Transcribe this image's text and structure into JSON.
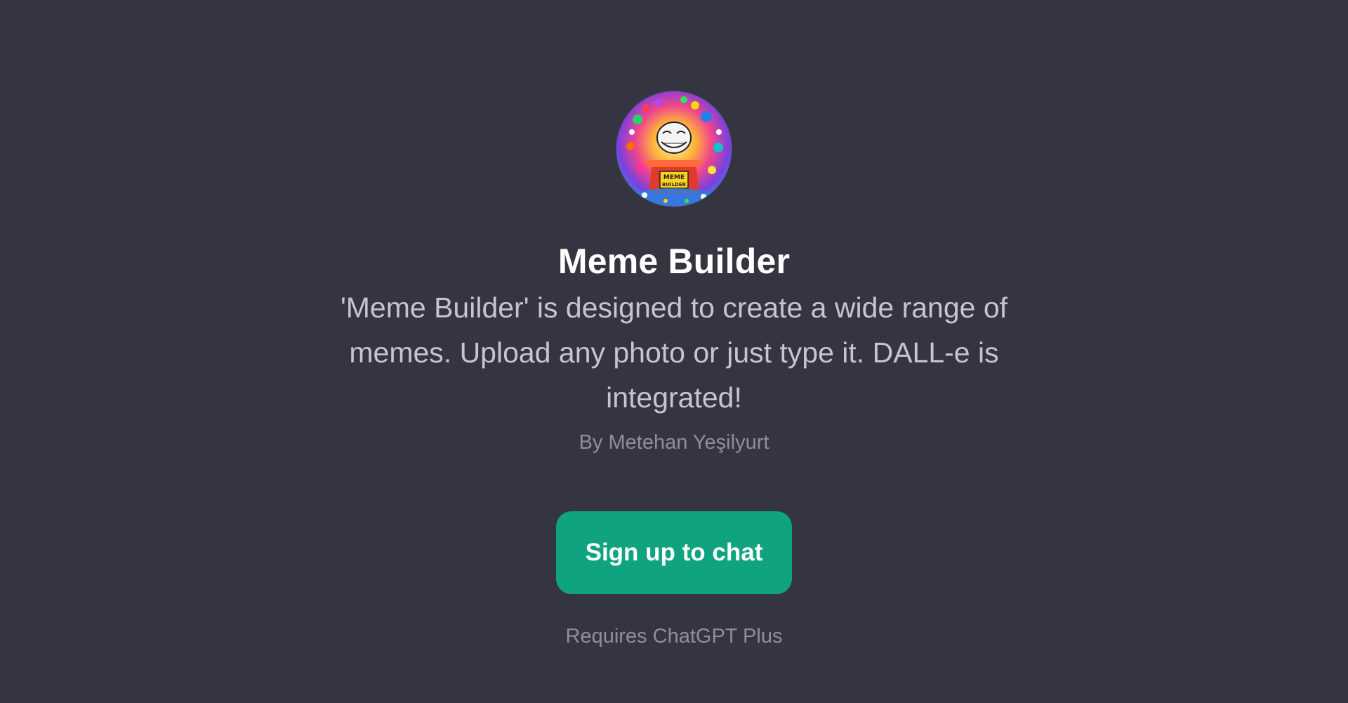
{
  "gpt": {
    "avatar": {
      "icon": "meme-builder-logo",
      "logo_text_line1": "MEME",
      "logo_text_line2": "BUILDER"
    },
    "title": "Meme Builder",
    "description": "'Meme Builder' is designed to create a wide range of memes. Upload any photo or just type it. DALL-e is integrated!",
    "author": "By Metehan Yeşilyurt"
  },
  "actions": {
    "signup_label": "Sign up to chat",
    "requirement": "Requires ChatGPT Plus"
  },
  "colors": {
    "background": "#343541",
    "accent": "#10a37f",
    "title": "#ffffff",
    "description": "#c5c5d2",
    "muted": "#8e8ea0"
  }
}
